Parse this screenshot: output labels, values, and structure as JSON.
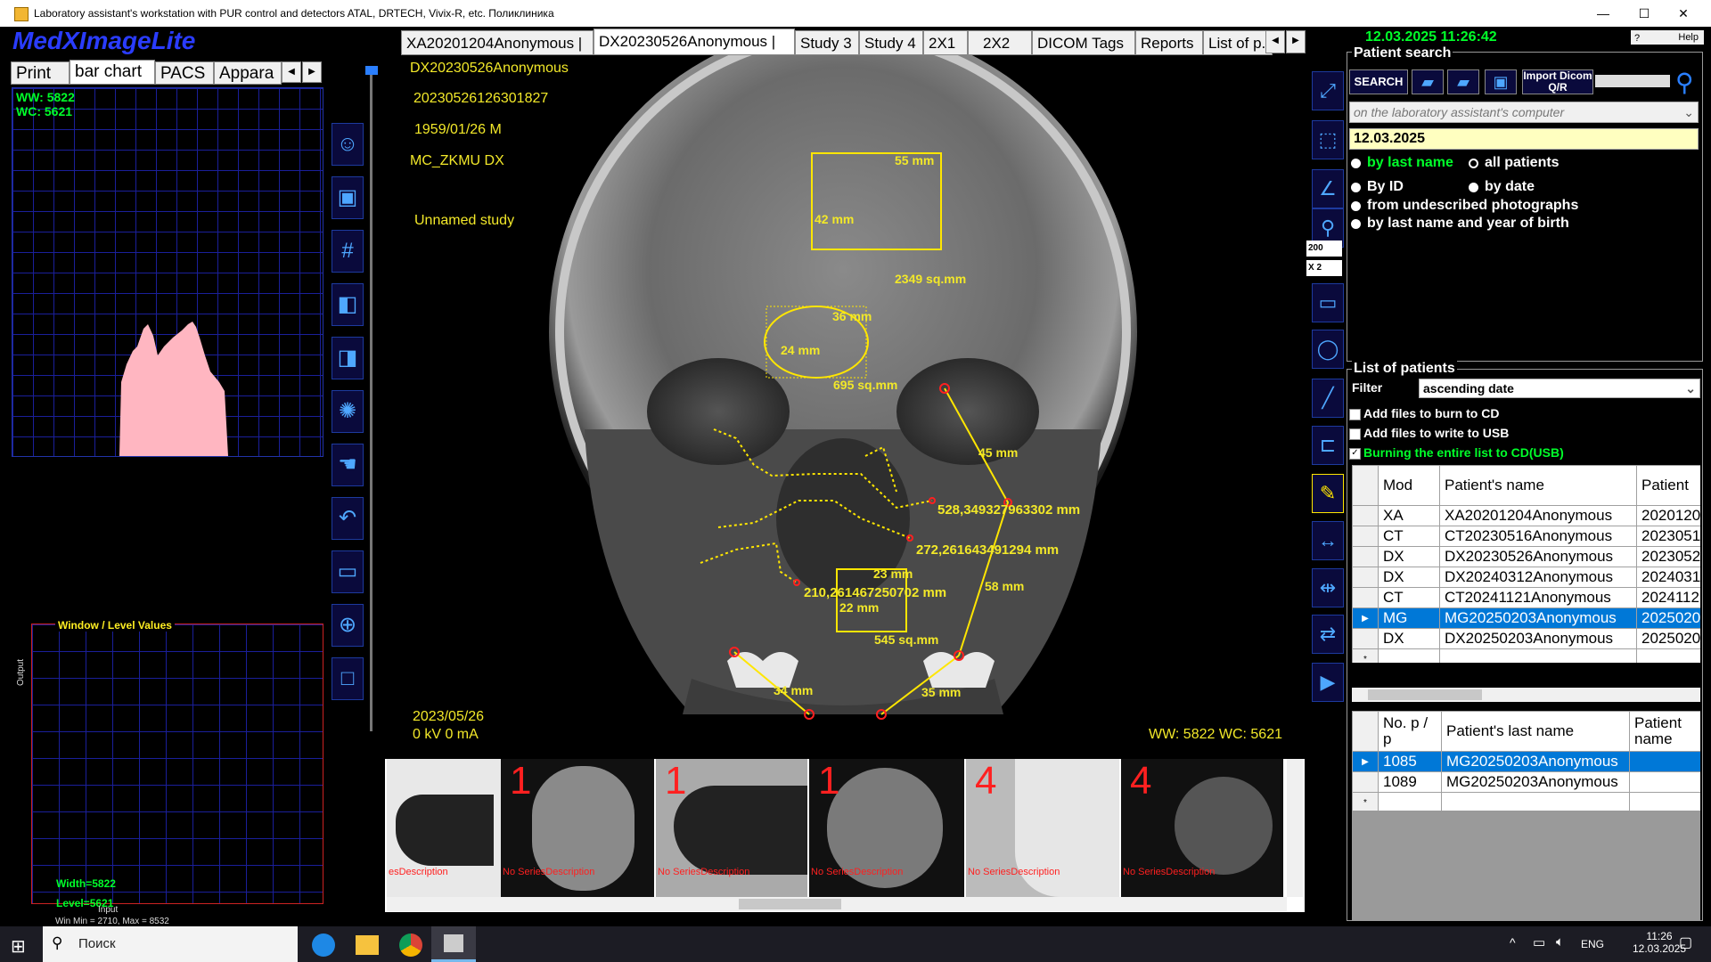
{
  "window": {
    "title": "Laboratory assistant's workstation with PUR control and detectors ATAL, DRTECH, Vivix-R, etc.  Поликлиника",
    "minimize": "—",
    "maximize": "☐",
    "close": "✕"
  },
  "app": {
    "logo": "MedXImageLite"
  },
  "left_tabs": [
    "Print",
    "bar chart",
    "PACS",
    "Appara"
  ],
  "histogram": {
    "ww": "WW: 5822",
    "wc": "WC: 5621"
  },
  "wl_panel": {
    "title": "Window / Level Values",
    "width": "Width=5822",
    "level": "Level=5621",
    "minmax": "Win Min = 2710, Max = 8532",
    "y_label": "Output",
    "x_label": "Input"
  },
  "study_tabs": [
    "XA20201204Anonymous |",
    "DX20230526Anonymous |",
    "Study 3",
    "Study 4",
    "2X1",
    "2X2",
    "DICOM Tags",
    "Reports",
    "List of p..."
  ],
  "viewer": {
    "patient_name": "DX20230526Anonymous",
    "study_id": "20230526126301827",
    "dob_sex": "1959/01/26   M",
    "institution": "MC_ZKMU DX",
    "study_desc": "Unnamed study",
    "date": "2023/05/26",
    "exposure": "0  kV   0  mA",
    "wwwc": "WW: 5822  WC: 5621",
    "measurements": {
      "rect_w": "55 mm",
      "rect_h": "42 mm",
      "rect_area": "2349 sq.mm",
      "ellipse_w": "36 mm",
      "ellipse_h": "24 mm",
      "ellipse_area": "695 sq.mm",
      "line1": "45 mm",
      "line2": "58 mm",
      "curve1": "528,349327963302 mm",
      "curve2": "272,261643491294 mm",
      "curve3": "210,261467250702 mm",
      "rect2_w": "23 mm",
      "rect2_h": "22 mm",
      "rect2_area": "545 sq.mm",
      "line3": "34 mm",
      "line4": "35 mm"
    }
  },
  "thumbnails": [
    {
      "num": "",
      "desc": "esDescription"
    },
    {
      "num": "1",
      "desc": "No SeriesDescription"
    },
    {
      "num": "1",
      "desc": "No SeriesDescription"
    },
    {
      "num": "1",
      "desc": "No SeriesDescription"
    },
    {
      "num": "4",
      "desc": "No SeriesDescription"
    },
    {
      "num": "4",
      "desc": "No SeriesDescription"
    }
  ],
  "right_tools": {
    "zoom_value": "200",
    "mult_value": "X 2"
  },
  "right_panel": {
    "datetime": "12.03.2025  11:26:42",
    "help": "Help",
    "patient_search_title": "Patient search",
    "search_button": "SEARCH",
    "import_button": "Import Dicom Q/R",
    "source_select": "on the laboratory assistant's computer",
    "date_field": "12.03.2025",
    "radios": [
      "by last name",
      "all patients",
      "By ID",
      "by date",
      "from undescribed photographs",
      "by last name and year of birth"
    ],
    "list_title": "List of patients",
    "filter_label": "Filter",
    "filter_value": "ascending date",
    "checkbox_cd": "Add files to burn to CD",
    "checkbox_usb": "Add files to write to USB",
    "checkbox_burn": "Burning the entire list to CD(USB)",
    "patients_headers": [
      "Mod",
      "Patient's name",
      "Patient"
    ],
    "patients": [
      {
        "mod": "XA",
        "name": "XA20201204Anonymous",
        "date": "2020120"
      },
      {
        "mod": "CT",
        "name": "CT20230516Anonymous",
        "date": "2023051"
      },
      {
        "mod": "DX",
        "name": "DX20230526Anonymous",
        "date": "2023052"
      },
      {
        "mod": "DX",
        "name": "DX20240312Anonymous",
        "date": "2024031"
      },
      {
        "mod": "CT",
        "name": "CT20241121Anonymous",
        "date": "2024112"
      },
      {
        "mod": "MG",
        "name": "MG20250203Anonymous",
        "date": "2025020"
      },
      {
        "mod": "DX",
        "name": "DX20250203Anonymous",
        "date": "2025020"
      }
    ],
    "studies_headers": [
      "No. p / p",
      "Patient's last name",
      "Patient name"
    ],
    "studies": [
      {
        "no": "1085",
        "name": "MG20250203Anonymous"
      },
      {
        "no": "1089",
        "name": "MG20250203Anonymous"
      }
    ]
  },
  "taskbar": {
    "search": "Поиск",
    "lang": "ENG",
    "time": "11:26",
    "date": "12.03.2025"
  }
}
